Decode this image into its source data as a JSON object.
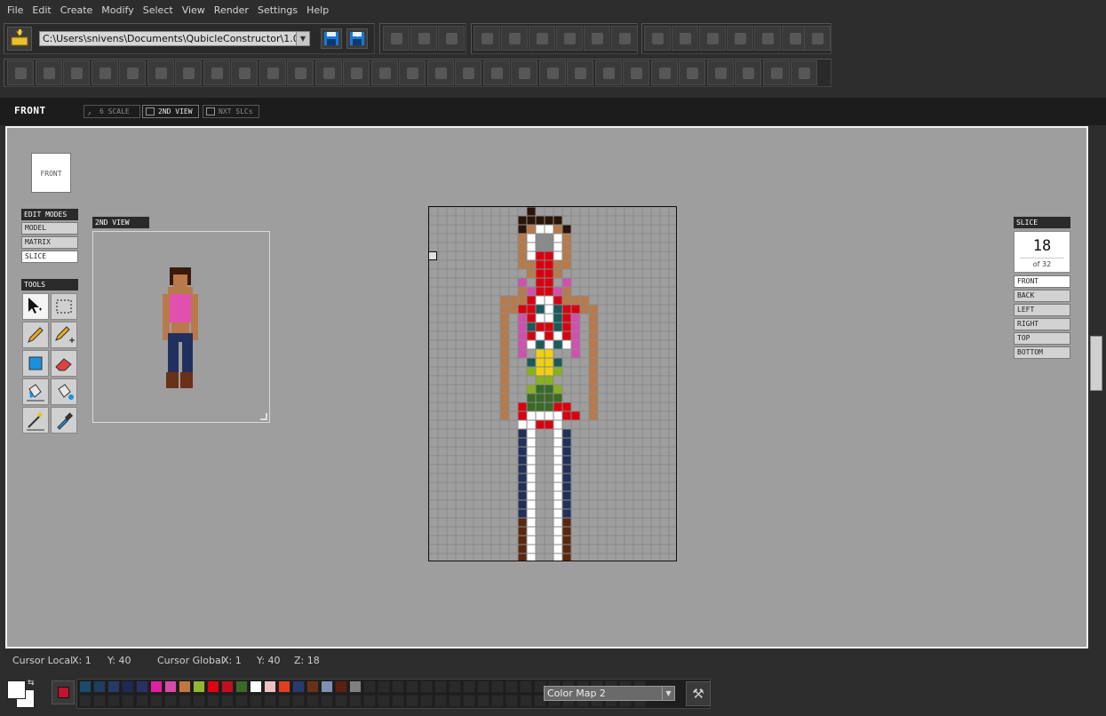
{
  "menu": [
    "File",
    "Edit",
    "Create",
    "Modify",
    "Select",
    "View",
    "Render",
    "Settings",
    "Help"
  ],
  "toolbar": {
    "path": "C:\\Users\\snivens\\Documents\\QubicleConstructor\\1.0\\Zpoc"
  },
  "view_tabs": {
    "title": "FRONT",
    "scale": "6 SCALE",
    "second_view": "2ND VIEW",
    "next_slices": "NXT SLCs"
  },
  "front_cube_label": "FRONT",
  "panels": {
    "edit_modes_title": "EDIT MODES",
    "edit_modes": [
      "MODEL",
      "MATRIX",
      "SLICE"
    ],
    "selected_edit_mode": "SLICE",
    "tools_title": "TOOLS",
    "tools": [
      "select-move-icon",
      "marquee-select-icon",
      "pencil-icon",
      "pencil-add-icon",
      "fill-square-icon",
      "eraser-icon",
      "paint-bucket-icon",
      "paint-bucket-all-icon",
      "magic-wand-icon",
      "eyedropper-icon"
    ],
    "second_view_title": "2ND VIEW"
  },
  "slice": {
    "title": "SLICE",
    "number": "18",
    "of": "of 32",
    "views": [
      "FRONT",
      "BACK",
      "LEFT",
      "RIGHT",
      "TOP",
      "BOTTOM"
    ],
    "selected_view": "FRONT"
  },
  "status": {
    "local_label": "Cursor Local",
    "local_x": "X:  1",
    "local_y": "Y:  40",
    "global_label": "Cursor Global",
    "global_x": "X:  1",
    "global_y": "Y:  40",
    "global_z": "Z:  18"
  },
  "current_color": "#c8102e",
  "palette": [
    "#1a4a6e",
    "#1e3e60",
    "#263a6a",
    "#1c2a55",
    "#2a2f66",
    "#e020a0",
    "#d84aa8",
    "#c07840",
    "#90b830",
    "#e00010",
    "#c01020",
    "#3a6a28",
    "#ffffff",
    "#f0c0c0",
    "#e04020",
    "#2a3a70",
    "#6a3018",
    "#8090b0",
    "#5a2010",
    "#808080"
  ],
  "color_map": "Color Map 2",
  "colors": {
    "viewport_bg": "#9e9e9e",
    "grid_line": "#8a8a8a",
    "accent": "#c8102e"
  }
}
